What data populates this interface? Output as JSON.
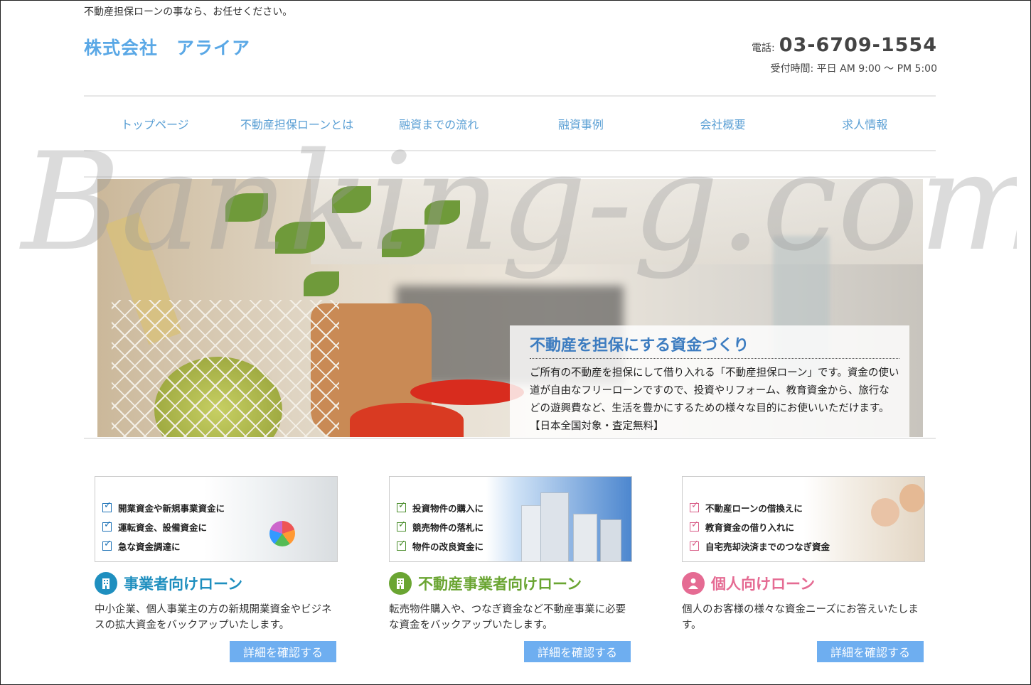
{
  "header": {
    "tagline": "不動産担保ローンの事なら、お任せください。",
    "logo": "株式会社　アライア",
    "phone_label": "電話:",
    "phone_number": "03-6709-1554",
    "hours": "受付時間: 平日 AM 9:00 ～ PM 5:00"
  },
  "nav": {
    "items": [
      "トップページ",
      "不動産担保ローンとは",
      "融資までの流れ",
      "融資事例",
      "会社概要",
      "求人情報"
    ]
  },
  "hero": {
    "title": "不動産を担保にする資金づくり",
    "text": "ご所有の不動産を担保にして借り入れる「不動産担保ローン」です。資金の使い道が自由なフリーローンですので、投資やリフォーム、教育資金から、旅行などの遊興費など、生活を豊かにするための様々な目的にお使いいただけます。【日本全国対象・査定無料】"
  },
  "cards": [
    {
      "checks": [
        "開業資金や新規事業資金に",
        "運転資金、設備資金に",
        "急な資金調達に"
      ],
      "title": "事業者向けローン",
      "text": "中小企業、個人事業主の方の新規開業資金やビジネスの拡大資金をバックアップいたします。",
      "button": "詳細を確認する",
      "color": "#1f8fbf",
      "icon": "building-icon"
    },
    {
      "checks": [
        "投資物件の購入に",
        "競売物件の落札に",
        "物件の改良資金に"
      ],
      "title": "不動産事業者向けローン",
      "text": "転売物件購入や、つなぎ資金など不動産事業に必要な資金をバックアップいたします。",
      "button": "詳細を確認する",
      "color": "#6aa532",
      "icon": "building-icon"
    },
    {
      "checks": [
        "不動産ローンの借換えに",
        "教育資金の借り入れに",
        "自宅売却決済までのつなぎ資金"
      ],
      "title": "個人向けローン",
      "text": "個人のお客様の様々な資金ニーズにお答えいたします。",
      "button": "詳細を確認する",
      "color": "#e56b93",
      "icon": "person-icon"
    }
  ],
  "watermark": "Banking-g.com"
}
